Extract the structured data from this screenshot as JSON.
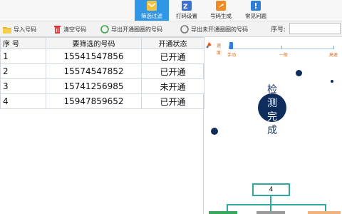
{
  "ribbon": {
    "tabs": [
      {
        "label": "筛选过滤",
        "icon": "filter-icon",
        "active": true
      },
      {
        "label": "打码设置",
        "icon": "barcode-settings-icon",
        "active": false
      },
      {
        "label": "号码生成",
        "icon": "number-generate-icon",
        "active": false
      },
      {
        "label": "常见问题",
        "icon": "faq-icon",
        "active": false
      }
    ]
  },
  "toolbar": {
    "import_label": "导入号码",
    "clear_label": "清空号码",
    "export_open_label": "导出开通圈圈的号码",
    "export_unopen_label": "导出未开通圈圈的号码",
    "serial_label": "序号:",
    "serial_value": ""
  },
  "table": {
    "headers": [
      "序 号",
      "要筛选的号码",
      "开通状态"
    ],
    "rows": [
      {
        "index": "1",
        "number": "15541547856",
        "status": "已开通"
      },
      {
        "index": "2",
        "number": "15574547852",
        "status": "已开通"
      },
      {
        "index": "3",
        "number": "15741256985",
        "status": "未开通"
      },
      {
        "index": "4",
        "number": "15947859652",
        "status": "已开通"
      }
    ]
  },
  "speed": {
    "label_1": "速",
    "label_2": "度",
    "ticks": [
      "手动",
      "一般",
      "高速"
    ]
  },
  "status_text": {
    "chars": [
      "检",
      "测",
      "完",
      "成"
    ]
  },
  "tree": {
    "root_value": "4"
  },
  "colors": {
    "accent": "#2f97e6",
    "navy": "#0f2d5c",
    "teal": "#2fa8a0"
  }
}
